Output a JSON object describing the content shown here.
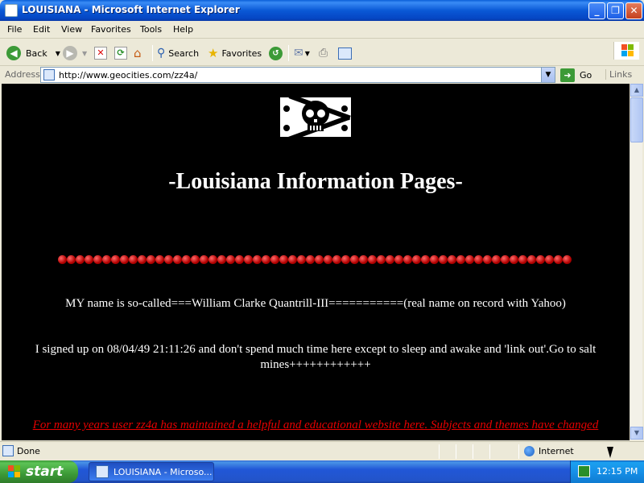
{
  "window": {
    "title": "LOUISIANA - Microsoft Internet Explorer",
    "controls": {
      "minimize": "_",
      "maximize": "❐",
      "close": "✕"
    }
  },
  "menu": [
    "File",
    "Edit",
    "View",
    "Favorites",
    "Tools",
    "Help"
  ],
  "toolbar": {
    "back_label": "Back",
    "search_label": "Search",
    "favorites_label": "Favorites"
  },
  "address": {
    "label": "Address",
    "url": "http://www.geocities.com/zz4a/",
    "go_label": "Go",
    "links_label": "Links"
  },
  "page": {
    "heading": "-Louisiana Information Pages-",
    "paragraph1": "MY name is so-called===William Clarke Quantrill-III===========(real name on record with Yahoo)",
    "paragraph2_line1": "I signed up on 08/04/49 21:11:26 and don't spend much time here except to sleep and awake and 'link out'.Go to salt",
    "paragraph2_line2": "mines++++++++++++",
    "red_notice": "For many years user zz4a has maintained a helpful and educational website here. Subjects and themes have changed",
    "bead_color": "#c00000"
  },
  "status": {
    "text": "Done",
    "zone": "Internet"
  },
  "taskbar": {
    "start_label": "start",
    "task_label": "LOUISIANA - Microso...",
    "clock": "12:15 PM"
  },
  "colors": {
    "page_background": "#000000",
    "page_text": "#ffffff",
    "notice_text": "#e60000",
    "xp_blue": "#0a59d6",
    "start_green": "#3c9a37"
  }
}
